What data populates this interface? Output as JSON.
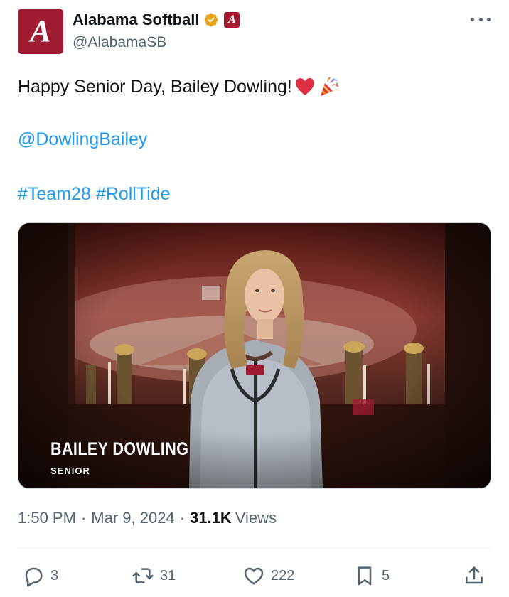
{
  "account": {
    "avatar_glyph": "A",
    "display_name": "Alabama Softball",
    "handle": "@AlabamaSB",
    "affiliate_glyph": "A",
    "brand_color": "#9e1b32",
    "verified_color": "#e8a317"
  },
  "tweet": {
    "line1": "Happy Senior Day, Bailey Dowling!",
    "emojis": [
      "red-heart",
      "party-popper"
    ],
    "mention": "@DowlingBailey",
    "hashtags": [
      "#Team28",
      "#RollTide"
    ]
  },
  "media": {
    "caption_name": "BAILEY DOWLING",
    "caption_subtitle": "SENIOR"
  },
  "meta": {
    "time": "1:50 PM",
    "separator": "·",
    "date": "Mar 9, 2024",
    "views_count": "31.1K",
    "views_label": "Views"
  },
  "actions": {
    "replies": "3",
    "reposts": "31",
    "likes": "222",
    "bookmarks": "5"
  },
  "colors": {
    "text_primary": "#0f1419",
    "text_secondary": "#536471",
    "link": "#1d9bf0"
  }
}
